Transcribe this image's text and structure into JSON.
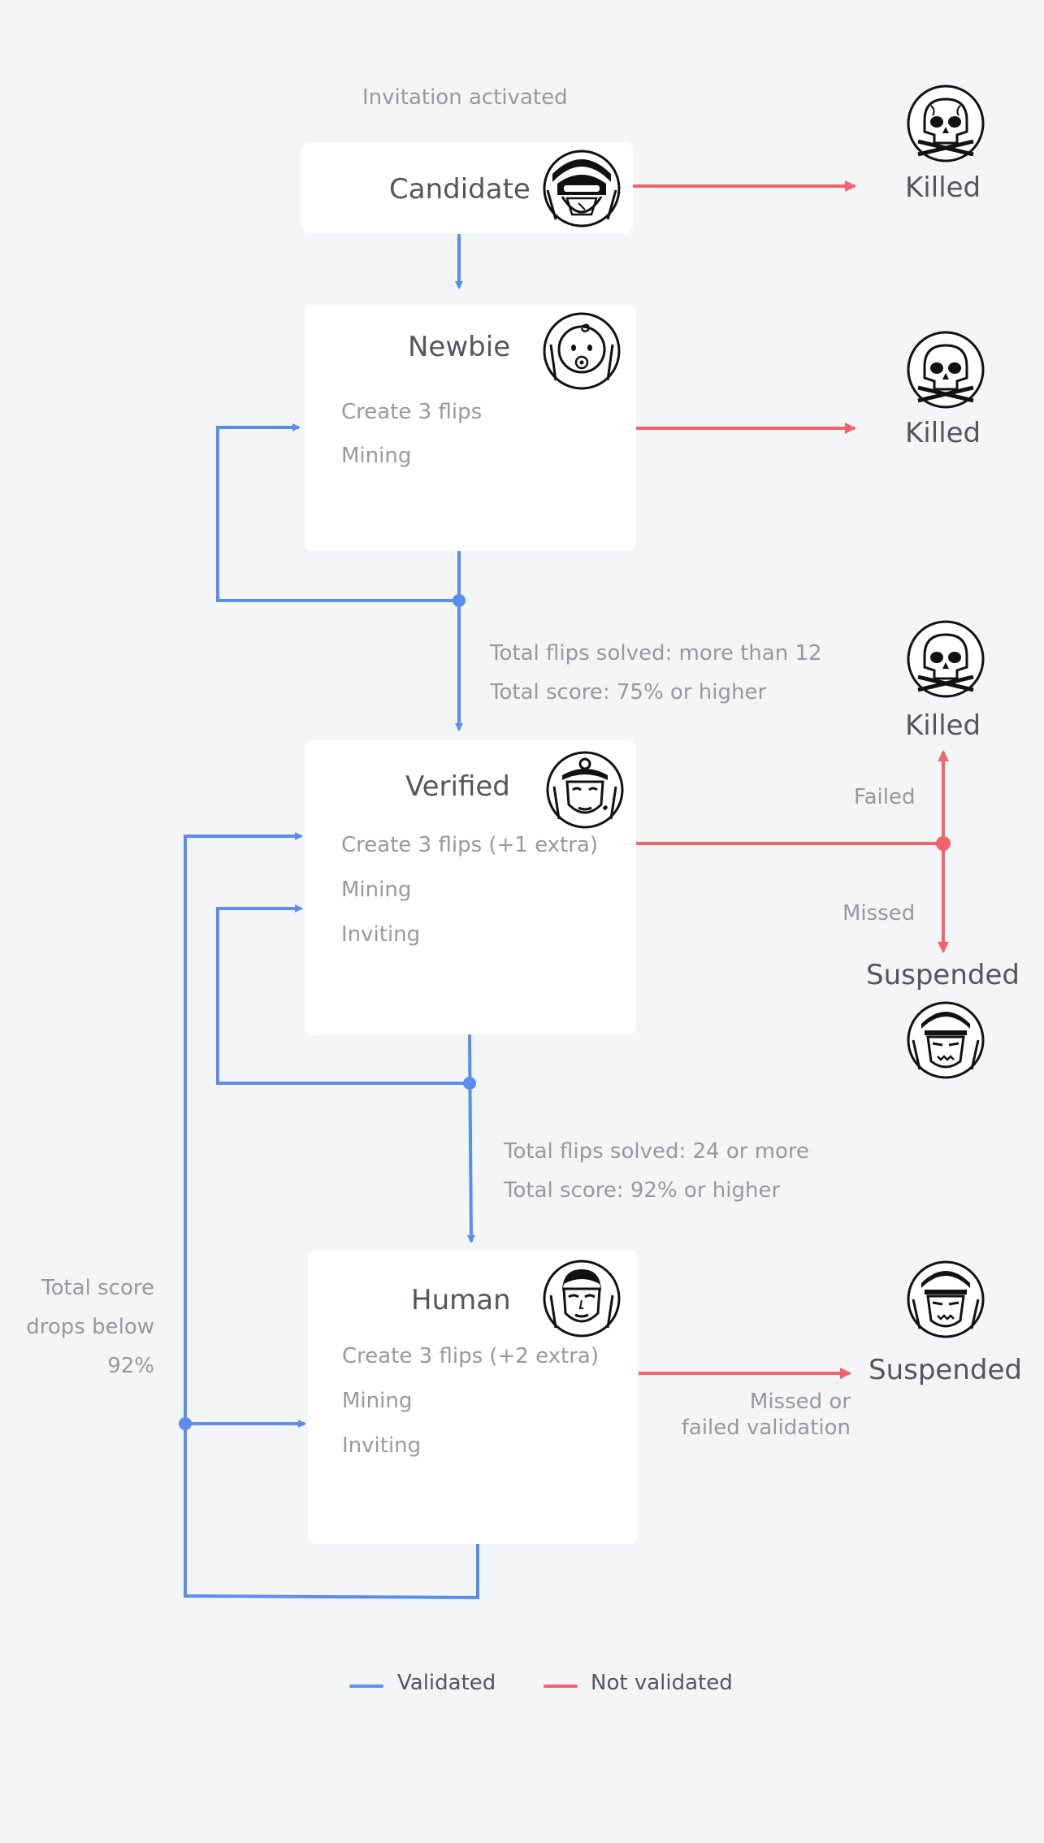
{
  "header": {
    "invitation": "Invitation activated"
  },
  "states": {
    "candidate": {
      "title": "Candidate"
    },
    "newbie": {
      "title": "Newbie",
      "items": [
        "Create 3 flips",
        "Mining"
      ]
    },
    "verified": {
      "title": "Verified",
      "items": [
        "Create 3 flips (+1 extra)",
        "Mining",
        "Inviting"
      ]
    },
    "human": {
      "title": "Human",
      "items": [
        "Create 3 flips (+2 extra)",
        "Mining",
        "Inviting"
      ]
    }
  },
  "transitions": {
    "newbie_to_verified": [
      "Total flips solved: more than 12",
      "Total score: 75% or higher"
    ],
    "verified_to_human": [
      "Total flips solved: 24 or more",
      "Total score: 92% or higher"
    ],
    "drop": [
      "Total score",
      "drops below",
      "92%"
    ],
    "failed": "Failed",
    "missed": "Missed",
    "human_missed": [
      "Missed or",
      "failed validation"
    ]
  },
  "outcomes": {
    "killed": "Killed",
    "suspended": "Suspended"
  },
  "legend": {
    "validated": "Validated",
    "not_validated": "Not validated"
  },
  "colors": {
    "validated": "#5b8def",
    "not_validated": "#f2636b",
    "card": "#ffffff",
    "background": "#f4f5f7"
  },
  "icons": {
    "candidate": "candidate-avatar-icon",
    "newbie": "newbie-avatar-icon",
    "verified": "verified-avatar-icon",
    "human": "human-avatar-icon",
    "killed": "skull-icon",
    "suspended": "suspended-avatar-icon"
  }
}
